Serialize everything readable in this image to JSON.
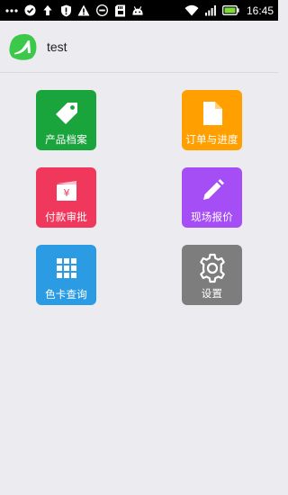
{
  "status_bar": {
    "time": "16:45",
    "icons": [
      "more-dots-icon",
      "check-circle-icon",
      "upload-arrow-icon",
      "shield-alert-icon",
      "warning-icon",
      "minus-circle-icon",
      "sd-card-icon",
      "android-icon",
      "wifi-icon",
      "signal-icon",
      "battery-icon"
    ]
  },
  "app_bar": {
    "title": "test",
    "logo_color": "#3cc84a"
  },
  "tiles": [
    {
      "label": "产品档案",
      "icon": "tag-icon",
      "color": "#1aa43c"
    },
    {
      "label": "订单与进度",
      "icon": "document-icon",
      "color": "#ff9f00"
    },
    {
      "label": "付款审批",
      "icon": "wallet-yen-icon",
      "color": "#f0385c"
    },
    {
      "label": "现场报价",
      "icon": "pencil-icon",
      "color": "#a64ef5"
    },
    {
      "label": "色卡查询",
      "icon": "grid-icon",
      "color": "#2b9be4"
    },
    {
      "label": "设置",
      "icon": "gear-icon",
      "color": "#7d7d7d"
    }
  ]
}
